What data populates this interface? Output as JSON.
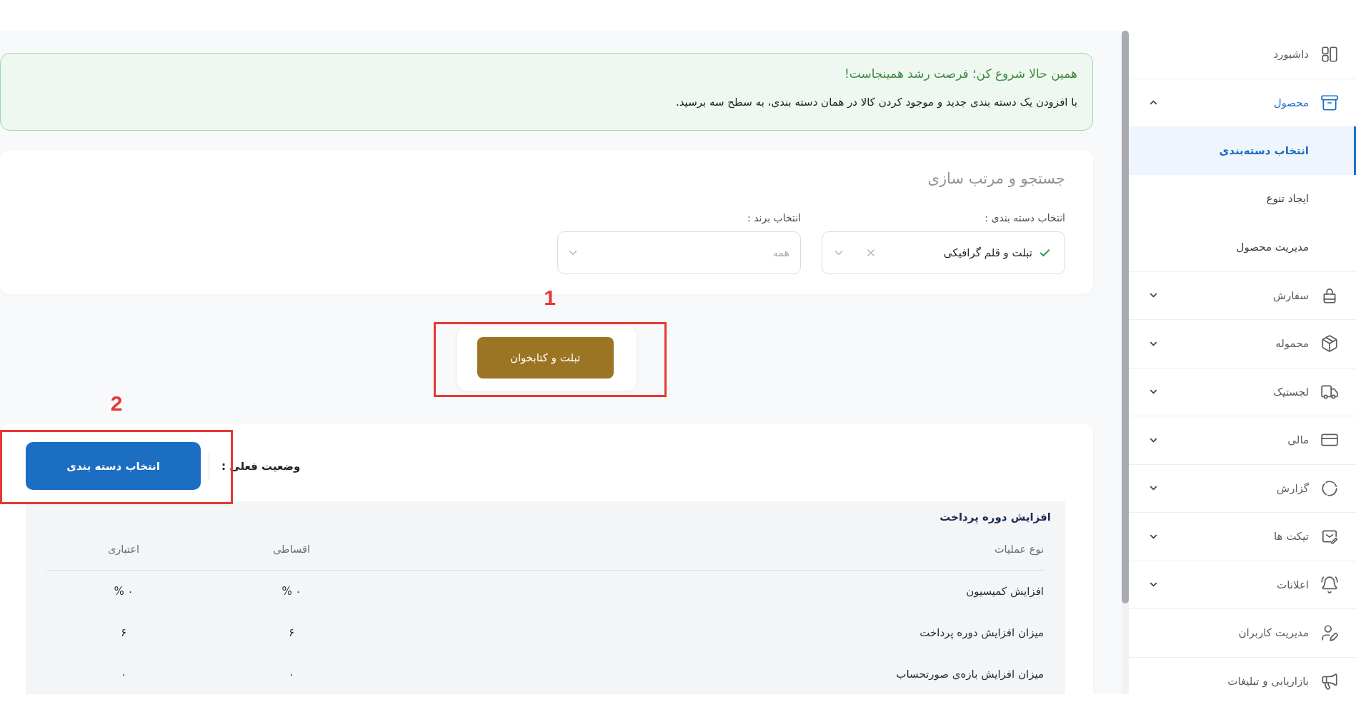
{
  "sidebar": {
    "items": [
      {
        "kind": "link",
        "label": "داشبورد",
        "selected": false
      },
      {
        "kind": "group",
        "label": "محصول",
        "selected": true,
        "expanded": true,
        "children": [
          {
            "label": "انتخاب دسته‌بندی",
            "selected": true
          },
          {
            "label": "ایجاد تنوع",
            "selected": false
          },
          {
            "label": "مدیریت محصول",
            "selected": false
          }
        ]
      },
      {
        "kind": "group",
        "label": "سفارش",
        "selected": false,
        "expanded": false
      },
      {
        "kind": "group",
        "label": "محموله",
        "selected": false,
        "expanded": false
      },
      {
        "kind": "group",
        "label": "لجستیک",
        "selected": false,
        "expanded": false
      },
      {
        "kind": "group",
        "label": "مالی",
        "selected": false,
        "expanded": false
      },
      {
        "kind": "group",
        "label": "گزارش",
        "selected": false,
        "expanded": false
      },
      {
        "kind": "group",
        "label": "تیکت ها",
        "selected": false,
        "expanded": false
      },
      {
        "kind": "group",
        "label": "اعلانات",
        "selected": false,
        "expanded": false
      },
      {
        "kind": "link",
        "label": "مدیریت کاربران",
        "selected": false
      },
      {
        "kind": "link",
        "label": "بازاریابی و تبلیغات",
        "selected": false
      }
    ]
  },
  "notice": {
    "title": "همین حالا شروع کن؛ فرصت رشد همینجاست!",
    "text": "با افزودن یک دسته بندی جدید و موجود کردن کالا در همان دسته بندی، به سطح سه برسید."
  },
  "filters": {
    "title": "جستجو و مرتب سازی",
    "fields": [
      {
        "label": "انتخاب دسته بندی :",
        "value": "تبلت و قلم گرافیکی"
      },
      {
        "label": "انتخاب برند :",
        "placeholder": "همه"
      }
    ]
  },
  "category_button": {
    "label": "تبلت و کتابخوان"
  },
  "status": {
    "label": "وضعیت فعلی :",
    "button": "انتخاب دسته بندی"
  },
  "table": {
    "title": "افزایش دوره پرداخت",
    "columns": [
      "نوع عملیات",
      "اقساطی",
      "اعتباری"
    ],
    "rows": [
      {
        "cells": [
          "افزایش کمیسیون",
          "۰ %",
          "۰ %"
        ]
      },
      {
        "cells": [
          "میزان افزایش دوره پرداخت",
          "۶",
          "۶"
        ]
      },
      {
        "cells": [
          "میزان افزایش بازه‌ی صورتحساب",
          "۰",
          "۰"
        ]
      }
    ]
  },
  "annotations": [
    {
      "label": "1"
    },
    {
      "label": "2"
    }
  ]
}
